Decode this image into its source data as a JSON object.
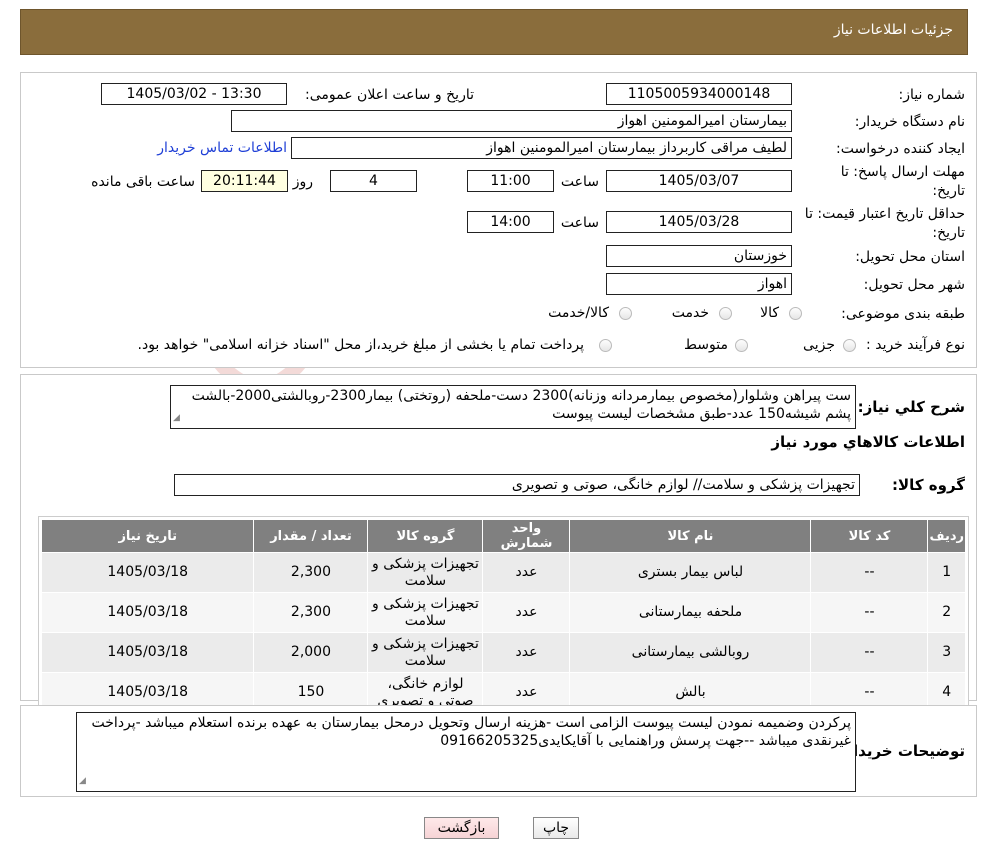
{
  "header": {
    "title": "جزئیات اطلاعات نیاز"
  },
  "fields": {
    "need_number_label": "شماره نیاز:",
    "need_number": "1105005934000148",
    "announce_label": "تاریخ و ساعت اعلان عمومی:",
    "announce_value": "1405/03/02 - 13:30",
    "buyer_label": "نام دستگاه خریدار:",
    "buyer": "بیمارستان امیرالمومنین اهواز",
    "creator_label": "ایجاد کننده درخواست:",
    "creator": "لطیف مراقی کاربرداز بیمارستان امیرالمومنین اهواز",
    "contact_link": "اطلاعات تماس خریدار",
    "reply_deadline_label": "مهلت ارسال پاسخ: تا تاریخ:",
    "reply_date": "1405/03/07",
    "time_label": "ساعت",
    "reply_time": "11:00",
    "days_value": "4",
    "days_label": "روز و",
    "remaining_value": "20:11:44",
    "remaining_label": "ساعت باقی مانده",
    "price_valid_label": "حداقل تاریخ اعتبار قیمت: تا تاریخ:",
    "price_valid_date": "1405/03/28",
    "price_valid_time": "14:00",
    "province_label": "استان محل تحویل:",
    "province": "خوزستان",
    "city_label": "شهر محل تحویل:",
    "city": "اهواز",
    "category_label": "طبقه بندی موضوعی:",
    "category_options": [
      "کالا",
      "خدمت",
      "کالا/خدمت"
    ],
    "process_label": "نوع فرآیند خرید :",
    "process_options": [
      "جزیی",
      "متوسط"
    ],
    "process_note": "پرداخت تمام یا بخشی از مبلغ خرید،از محل \"اسناد خزانه اسلامی\" خواهد بود."
  },
  "summary": {
    "label": "شرح کلي نياز:",
    "text": "ست پیراهن وشلوار(مخصوص بیمارمردانه وزنانه)2300 دست-ملحفه (روتختی) بیمار2300-روبالشتی2000-بالشت پشم شیشه150 عدد-طبق مشخصات لیست پیوست"
  },
  "goods": {
    "section_title": "اطلاعات کالاهاي مورد نياز",
    "group_label": "گروه کالا:",
    "group_value": "تجهیزات پزشکی و سلامت// لوازم خانگی، صوتی و تصویری",
    "columns": [
      "ردیف",
      "کد کالا",
      "نام کالا",
      "واحد شمارش",
      "گروه کالا",
      "تعداد / مقدار",
      "تاریخ نیاز"
    ],
    "rows": [
      {
        "row": "1",
        "code": "--",
        "name": "لباس بیمار بستری",
        "unit": "عدد",
        "group": "تجهیزات پزشکی و سلامت",
        "qty": "2,300",
        "date": "1405/03/18"
      },
      {
        "row": "2",
        "code": "--",
        "name": "ملحفه بیمارستانی",
        "unit": "عدد",
        "group": "تجهیزات پزشکی و سلامت",
        "qty": "2,300",
        "date": "1405/03/18"
      },
      {
        "row": "3",
        "code": "--",
        "name": "روبالشی بیمارستانی",
        "unit": "عدد",
        "group": "تجهیزات پزشکی و سلامت",
        "qty": "2,000",
        "date": "1405/03/18"
      },
      {
        "row": "4",
        "code": "--",
        "name": "بالش",
        "unit": "عدد",
        "group": "لوازم خانگی، صوتی و تصویری",
        "qty": "150",
        "date": "1405/03/18"
      }
    ]
  },
  "buyer_notes": {
    "label": "توضیحات خریدار:",
    "text": "پرکردن وضمیمه نمودن لیست پیوست الزامی است -هزینه ارسال وتحویل درمحل بیمارستان به عهده برنده استعلام میباشد -پرداخت غیرنقدی میباشد --جهت پرسش وراهنمایی با آقایکایدی09166205325"
  },
  "buttons": {
    "print": "چاپ",
    "back": "بازگشت"
  },
  "watermark": "AriaTender.neT",
  "colors": {
    "header_bg": "#8a6d3c",
    "table_header": "#808080",
    "link": "#1f3fd6"
  }
}
